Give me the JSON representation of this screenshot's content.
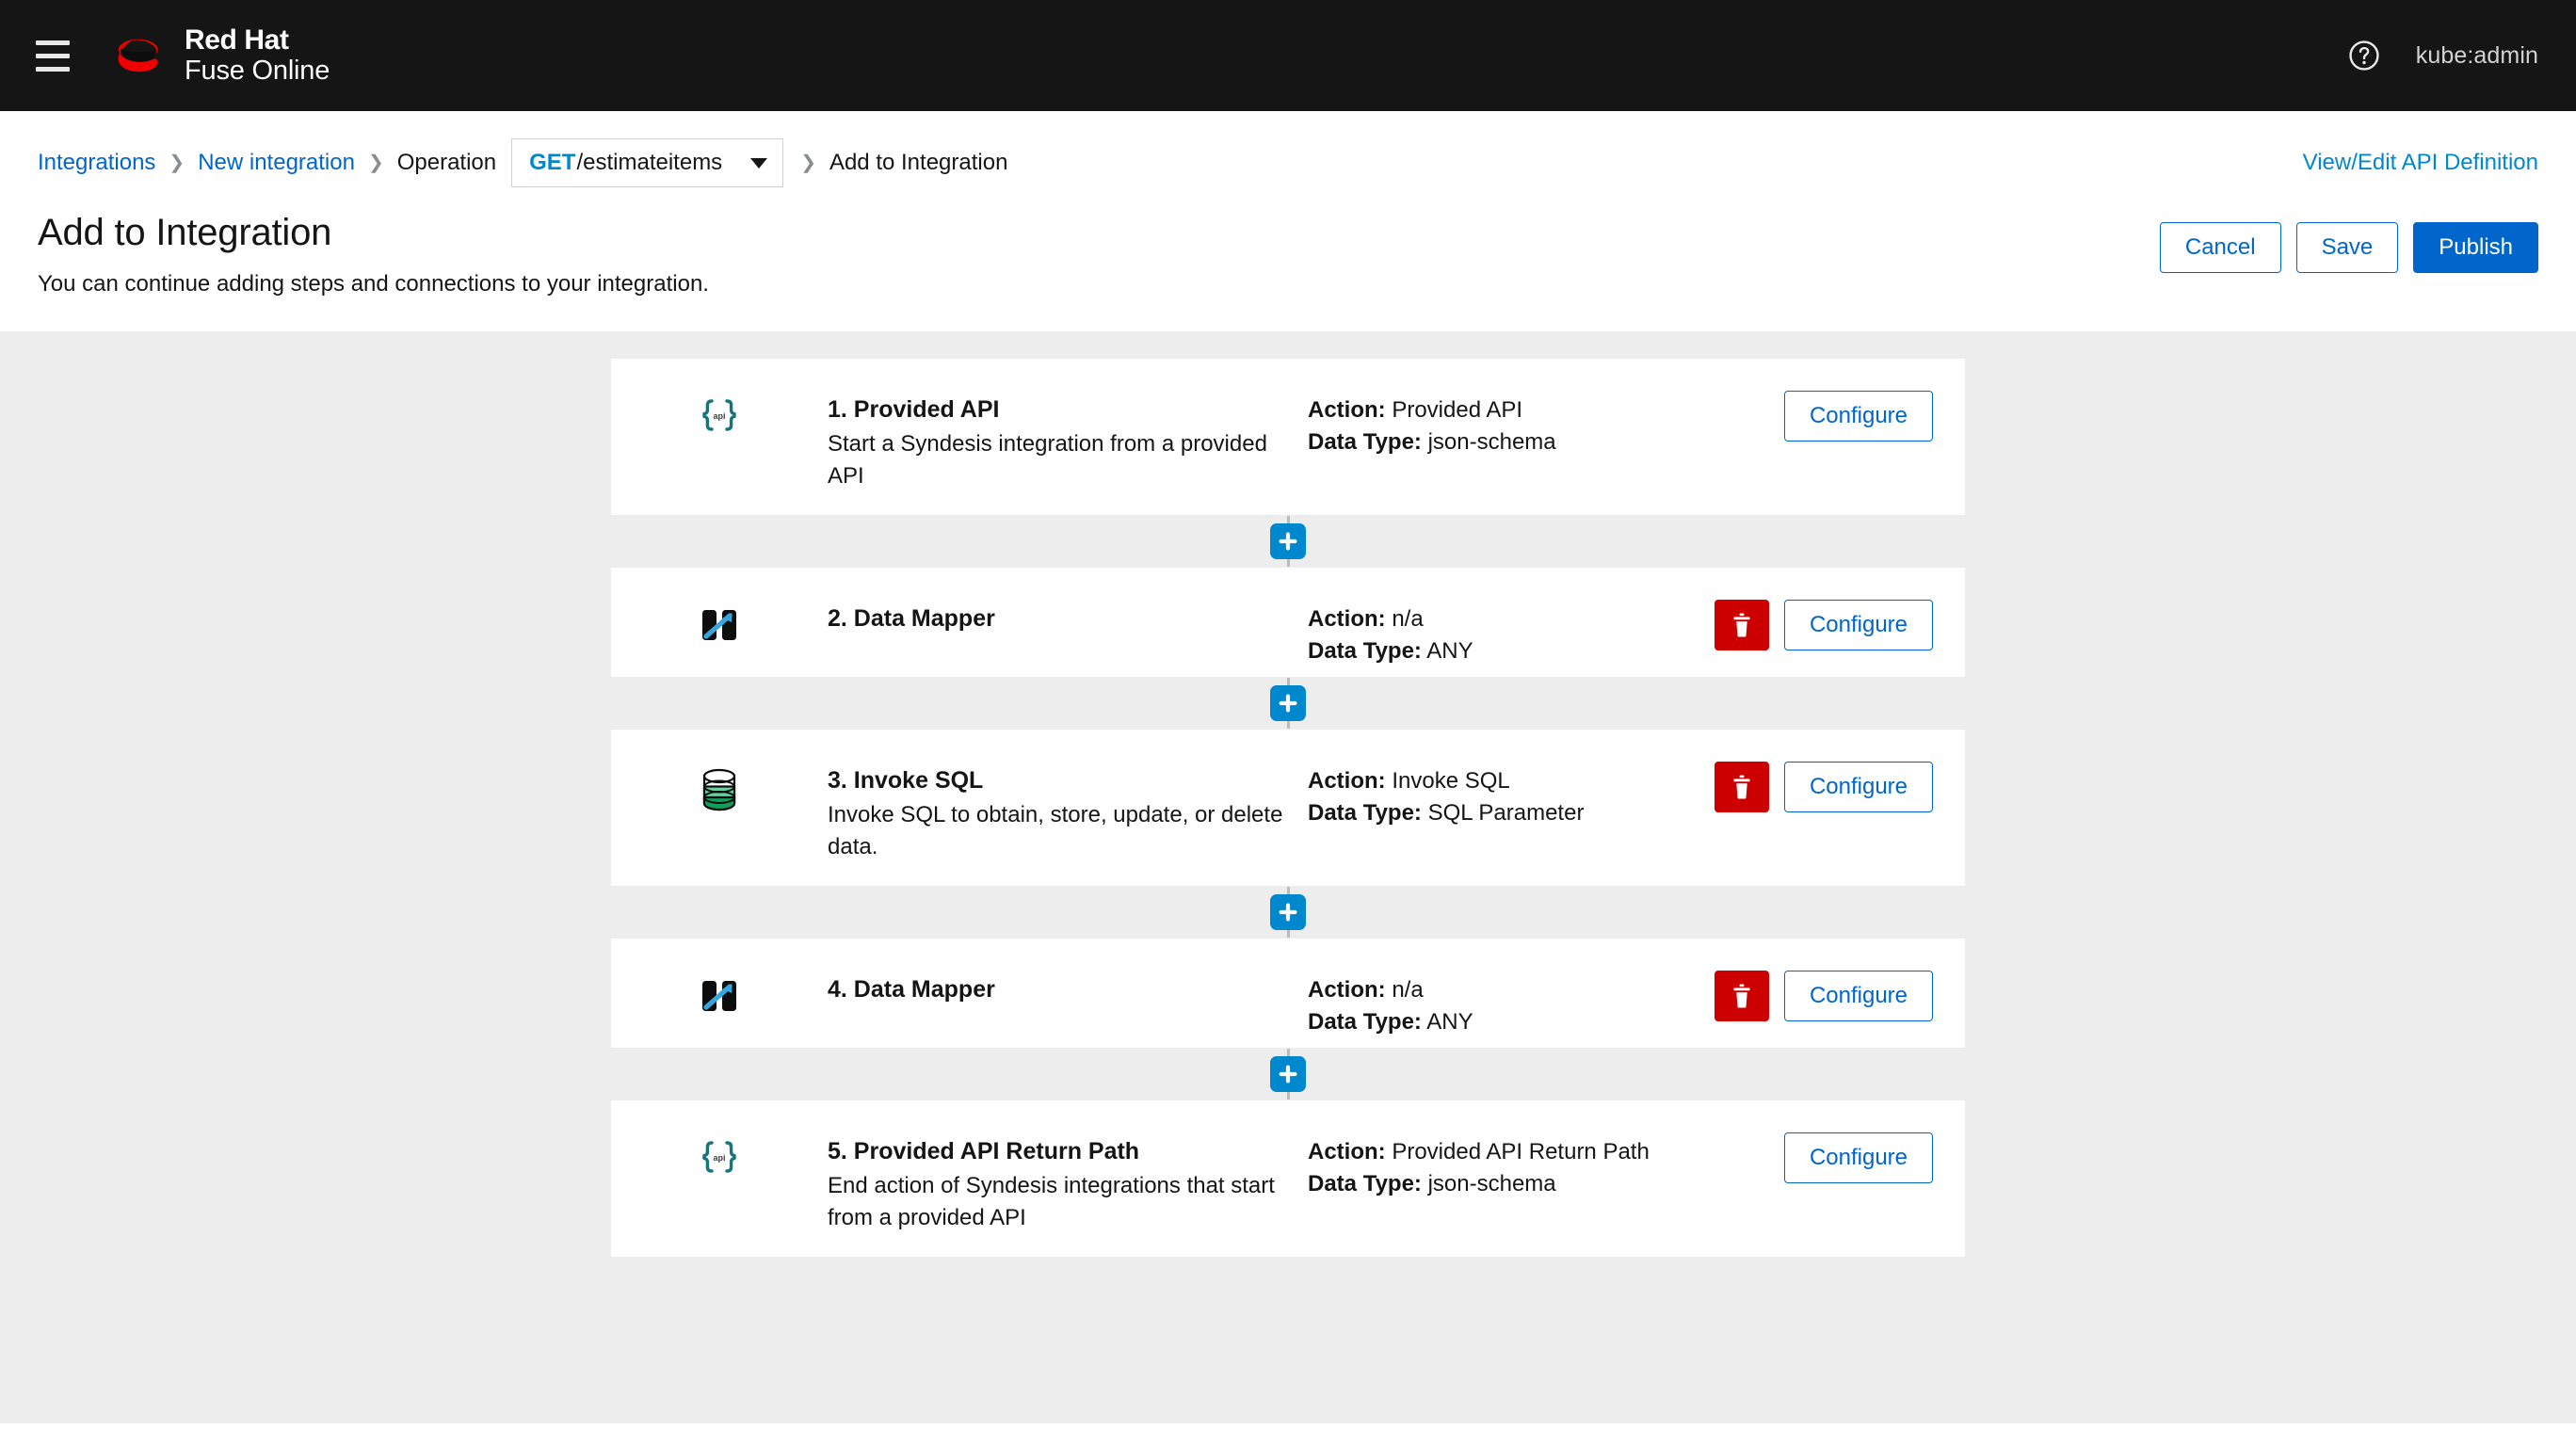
{
  "masthead": {
    "menu_icon": "hamburger-icon",
    "brand_line1": "Red Hat",
    "brand_line2": "Fuse Online",
    "help_icon": "help-circle-icon",
    "username": "kube:admin"
  },
  "breadcrumb": {
    "items": [
      {
        "label": "Integrations",
        "type": "link"
      },
      {
        "label": "New integration",
        "type": "link"
      },
      {
        "label": "Operation",
        "type": "plain"
      },
      {
        "label": "Add to Integration",
        "type": "plain"
      }
    ],
    "operation_select": {
      "verb": "GET",
      "path": "/estimateitems",
      "caret_icon": "chevron-down-icon"
    },
    "api_definition_link": "View/Edit API Definition"
  },
  "page": {
    "title": "Add to Integration",
    "subtitle": "You can continue adding steps and connections to your integration."
  },
  "toolbar": {
    "cancel_label": "Cancel",
    "save_label": "Save",
    "publish_label": "Publish"
  },
  "labels": {
    "action": "Action:",
    "data_type": "Data Type:",
    "configure": "Configure",
    "delete_icon": "trash-icon",
    "add_step_icon": "plus-icon"
  },
  "colors": {
    "masthead_bg": "#151515",
    "canvas_bg": "#ededed",
    "primary_blue": "#0066cc",
    "link_blue": "#0088ce",
    "danger_red": "#cc0000",
    "add_button_blue": "#0088ce",
    "api_icon_teal": "#17757a",
    "mapper_icon_blue": "#39a5dc",
    "db_icon_green": "#0f9d58"
  },
  "steps": [
    {
      "icon": "provided-api-icon",
      "title": "1. Provided API",
      "description": "Start a Syndesis integration from a provided API",
      "action": "Provided API",
      "data_type": "json-schema",
      "has_delete": false
    },
    {
      "icon": "data-mapper-icon",
      "title": "2. Data Mapper",
      "description": "",
      "action": "n/a",
      "data_type": "ANY",
      "has_delete": true
    },
    {
      "icon": "database-icon",
      "title": "3. Invoke SQL",
      "description": "Invoke SQL to obtain, store, update, or delete data.",
      "action": "Invoke SQL",
      "data_type": "SQL Parameter",
      "has_delete": true
    },
    {
      "icon": "data-mapper-icon",
      "title": "4. Data Mapper",
      "description": "",
      "action": "n/a",
      "data_type": "ANY",
      "has_delete": true
    },
    {
      "icon": "provided-api-icon",
      "title": "5. Provided API Return Path",
      "description": "End action of Syndesis integrations that start from a provided API",
      "action": "Provided API Return Path",
      "data_type": "json-schema",
      "has_delete": false
    }
  ]
}
